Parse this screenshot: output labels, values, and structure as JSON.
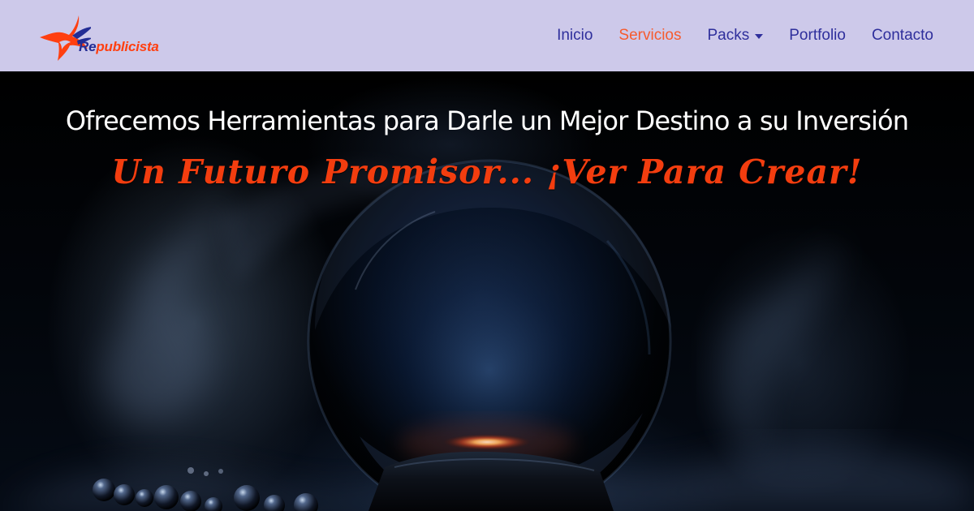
{
  "brand": {
    "prefix": "Re",
    "suffix": "publicista",
    "mark_icon": "orange-star-icon",
    "colors": {
      "blue": "#232d95",
      "orange": "#ff3f10"
    }
  },
  "navigation": {
    "items": [
      {
        "label": "Inicio",
        "active": false
      },
      {
        "label": "Servicios",
        "active": true
      },
      {
        "label": "Packs",
        "active": false,
        "icon": "chevron-down-icon"
      },
      {
        "label": "Portfolio",
        "active": false
      },
      {
        "label": "Contacto",
        "active": false
      }
    ],
    "colors": {
      "default": "#2f2f9c",
      "active": "#f65b2e",
      "background": "#cdc9ea"
    }
  },
  "hero": {
    "title": "Ofrecemos Herramientas para Darle un Mejor Destino a su Inversión",
    "subtitle": "Un Futuro Promisor... ¡Ver Para Crear!",
    "image_icon": "crystal-ball-icon",
    "colors": {
      "title": "#ffffff",
      "subtitle": "#f33d0f",
      "background": "#000000"
    }
  }
}
